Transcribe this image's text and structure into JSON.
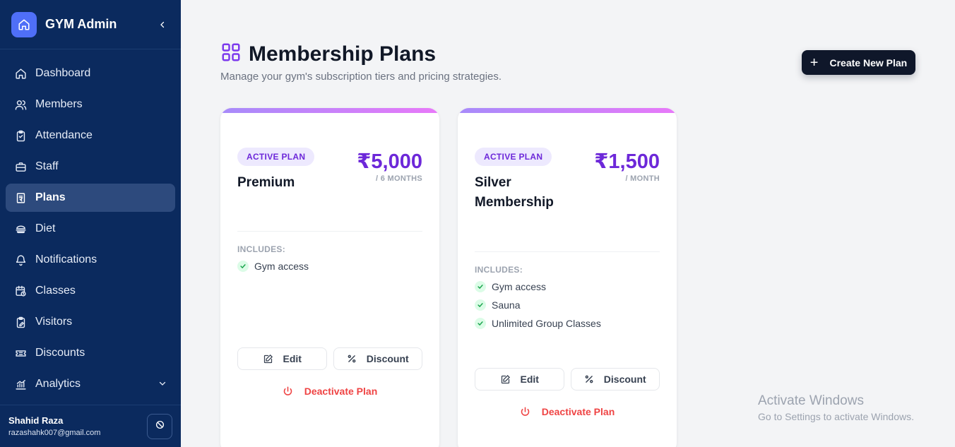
{
  "sidebar": {
    "brand": "GYM Admin",
    "items": [
      {
        "label": "Dashboard",
        "icon": "home-icon"
      },
      {
        "label": "Members",
        "icon": "users-icon"
      },
      {
        "label": "Attendance",
        "icon": "clipboard-icon"
      },
      {
        "label": "Staff",
        "icon": "briefcase-icon"
      },
      {
        "label": "Plans",
        "icon": "receipt-icon",
        "active": true
      },
      {
        "label": "Diet",
        "icon": "burger-icon"
      },
      {
        "label": "Notifications",
        "icon": "bell-icon"
      },
      {
        "label": "Classes",
        "icon": "calendar-clock-icon"
      },
      {
        "label": "Visitors",
        "icon": "clipboard-edit-icon"
      },
      {
        "label": "Discounts",
        "icon": "ticket-icon"
      },
      {
        "label": "Analytics",
        "icon": "chart-icon"
      }
    ],
    "user": {
      "name": "Shahid Raza",
      "email": "razashahk007@gmail.com"
    }
  },
  "header": {
    "title": "Membership Plans",
    "subtitle": "Manage your gym's subscription tiers and pricing strategies.",
    "create_label": "Create New Plan"
  },
  "plans": [
    {
      "badge": "ACTIVE PLAN",
      "name": "Premium",
      "price": "₹5,000",
      "duration": "/ 6 MONTHS",
      "includes_label": "INCLUDES:",
      "features": [
        "Gym access"
      ],
      "edit_label": "Edit",
      "discount_label": "Discount",
      "deactivate_label": "Deactivate Plan"
    },
    {
      "badge": "ACTIVE PLAN",
      "name": "Silver Membership",
      "price": "₹1,500",
      "duration": "/ MONTH",
      "includes_label": "INCLUDES:",
      "features": [
        "Gym access",
        "Sauna",
        "Unlimited Group Classes"
      ],
      "edit_label": "Edit",
      "discount_label": "Discount",
      "deactivate_label": "Deactivate Plan"
    }
  ],
  "watermark": {
    "title": "Activate Windows",
    "subtitle": "Go to Settings to activate Windows."
  },
  "colors": {
    "sidebar_bg": "#0b2a5e",
    "accent": "#6d28d9",
    "danger": "#ef4444",
    "success": "#16a34a"
  }
}
